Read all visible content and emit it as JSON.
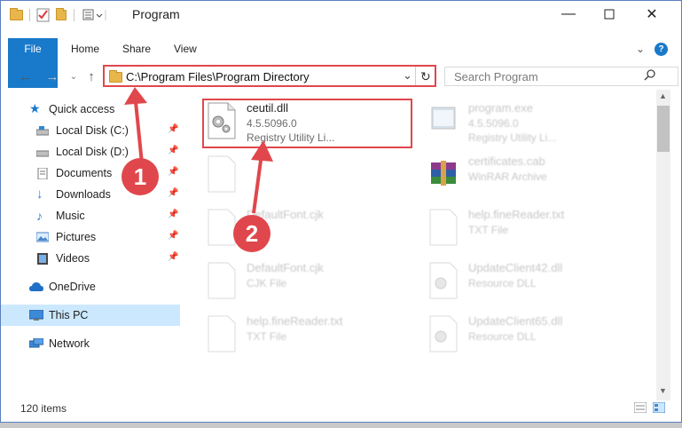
{
  "window": {
    "title": "Program"
  },
  "ribbon": {
    "tabs": [
      "File",
      "Home",
      "Share",
      "View"
    ]
  },
  "address": {
    "path": "C:\\Program Files\\Program Directory"
  },
  "search": {
    "placeholder": "Search Program"
  },
  "sidebar": {
    "quick_access": "Quick access",
    "items": [
      {
        "label": "Local Disk (C:)",
        "icon": "drive-icon"
      },
      {
        "label": "Local Disk (D:)",
        "icon": "drive-icon"
      },
      {
        "label": "Documents",
        "icon": "documents-icon"
      },
      {
        "label": "Downloads",
        "icon": "downloads-icon"
      },
      {
        "label": "Music",
        "icon": "music-icon"
      },
      {
        "label": "Pictures",
        "icon": "pictures-icon"
      },
      {
        "label": "Videos",
        "icon": "videos-icon"
      }
    ],
    "onedrive": "OneDrive",
    "this_pc": "This PC",
    "network": "Network"
  },
  "files": [
    {
      "name": "ceutil.dll",
      "line1": "4.5.5096.0",
      "line2": "Registry Utility Li..."
    },
    {
      "name": "program.exe",
      "line1": "4.5.5096.0",
      "line2": "Registry Utility Li..."
    },
    {
      "name": "",
      "line1": "",
      "line2": ""
    },
    {
      "name": "certificates.cab",
      "line1": "WinRAR Archive",
      "line2": ""
    },
    {
      "name": "DefaultFont.cjk",
      "line1": "",
      "line2": ""
    },
    {
      "name": "help.fineReader.txt",
      "line1": "TXT File",
      "line2": ""
    },
    {
      "name": "DefaultFont.cjk",
      "line1": "CJK File",
      "line2": ""
    },
    {
      "name": "UpdateClient42.dll",
      "line1": "Resource DLL",
      "line2": ""
    },
    {
      "name": "help.fineReader.txt",
      "line1": "TXT File",
      "line2": ""
    },
    {
      "name": "UpdateClient65.dll",
      "line1": "Resource DLL",
      "line2": ""
    }
  ],
  "status": {
    "count": "120 items"
  },
  "markers": [
    "1",
    "2"
  ],
  "colors": {
    "accent": "#1979ca",
    "highlight": "#e0474c",
    "selected": "#cce8ff"
  }
}
